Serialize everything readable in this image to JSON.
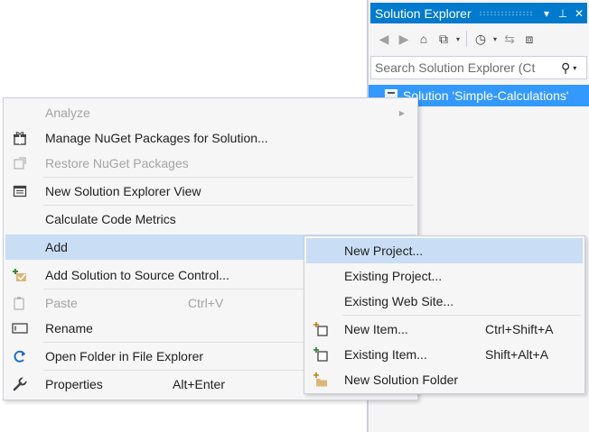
{
  "solution_explorer": {
    "title": "Solution Explorer",
    "search_placeholder": "Search Solution Explorer (Ct",
    "tree": [
      {
        "label": "Solution 'Simple-Calculations'"
      }
    ]
  },
  "context_menu": {
    "items": [
      {
        "label": "Analyze",
        "disabled": true,
        "submenu": true
      },
      {
        "label": "Manage NuGet Packages for Solution...",
        "icon": "nuget-icon"
      },
      {
        "label": "Restore NuGet Packages",
        "disabled": true,
        "icon": "restore-icon"
      },
      {
        "label": "New Solution Explorer View",
        "icon": "new-view-icon"
      },
      {
        "label": "Calculate Code Metrics"
      },
      {
        "label": "Add",
        "highlighted": true
      },
      {
        "label": "Add Solution to Source Control...",
        "icon": "source-control-icon"
      },
      {
        "label": "Paste",
        "shortcut": "Ctrl+V",
        "disabled": true,
        "icon": "paste-icon"
      },
      {
        "label": "Rename",
        "icon": "rename-icon"
      },
      {
        "label": "Open Folder in File Explorer",
        "icon": "refresh-folder-icon"
      },
      {
        "label": "Properties",
        "shortcut": "Alt+Enter",
        "icon": "wrench-icon"
      }
    ]
  },
  "add_submenu": {
    "items": [
      {
        "label": "New Project...",
        "highlighted": true
      },
      {
        "label": "Existing Project..."
      },
      {
        "label": "Existing Web Site..."
      },
      {
        "label": "New Item...",
        "shortcut": "Ctrl+Shift+A",
        "icon": "new-item-icon"
      },
      {
        "label": "Existing Item...",
        "shortcut": "Shift+Alt+A",
        "icon": "existing-item-icon"
      },
      {
        "label": "New Solution Folder",
        "icon": "new-folder-icon"
      }
    ]
  },
  "colors": {
    "accent": "#007acc",
    "selection": "#3399ff",
    "menu_highlight": "#c9def5",
    "menu_background": "#f6f6f6"
  }
}
